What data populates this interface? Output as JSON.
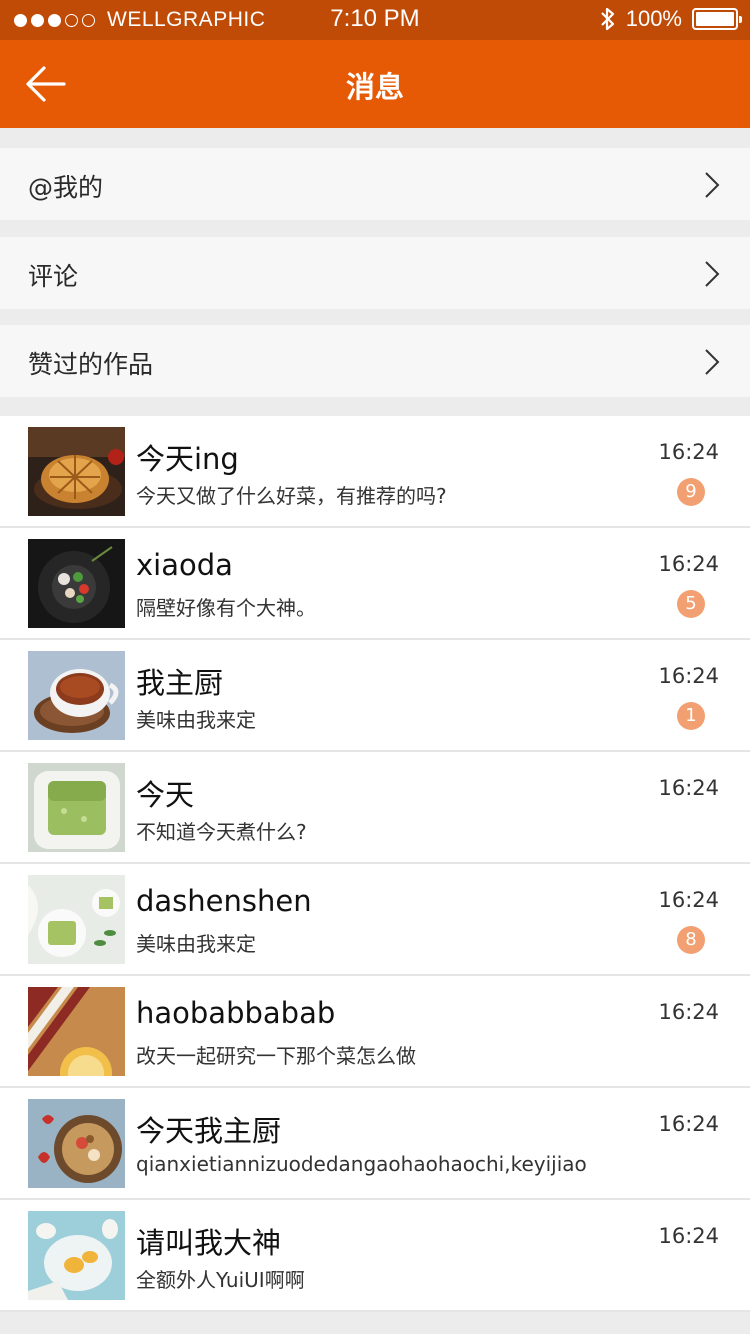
{
  "status_bar": {
    "carrier": "WELLGRAPHIC",
    "time": "7:10 PM",
    "battery": "100%",
    "signal_bars_filled": 3,
    "signal_bars_total": 5
  },
  "nav": {
    "title": "消息",
    "back_icon": "arrow-left-icon"
  },
  "menu_items": [
    {
      "label": "@我的"
    },
    {
      "label": "评论"
    },
    {
      "label": "赞过的作品"
    }
  ],
  "messages": [
    {
      "name": "今天ing",
      "preview": "今天又做了什么好菜，有推荐的吗?",
      "time": "16:24",
      "badge": "9"
    },
    {
      "name": "xiaoda",
      "preview": "隔壁好像有个大神。",
      "time": "16:24",
      "badge": "5"
    },
    {
      "name": "我主厨",
      "preview": "美味由我来定",
      "time": "16:24",
      "badge": "1"
    },
    {
      "name": "今天",
      "preview": "不知道今天煮什么?",
      "time": "16:24",
      "badge": ""
    },
    {
      "name": "dashenshen",
      "preview": "美味由我来定",
      "time": "16:24",
      "badge": "8"
    },
    {
      "name": "haobabbabab",
      "preview": "改天一起研究一下那个菜怎么做",
      "time": "16:24",
      "badge": ""
    },
    {
      "name": "今天我主厨",
      "preview": "qianxietiannizuodedangaohaohaochi,keyijiao",
      "time": "16:24",
      "badge": ""
    },
    {
      "name": "请叫我大神",
      "preview": "全额外人YuiUI啊啊",
      "time": "16:24",
      "badge": ""
    }
  ],
  "colors": {
    "status_bar": "#bf4b07",
    "nav_bar": "#e65a05",
    "badge": "#f2a071"
  }
}
